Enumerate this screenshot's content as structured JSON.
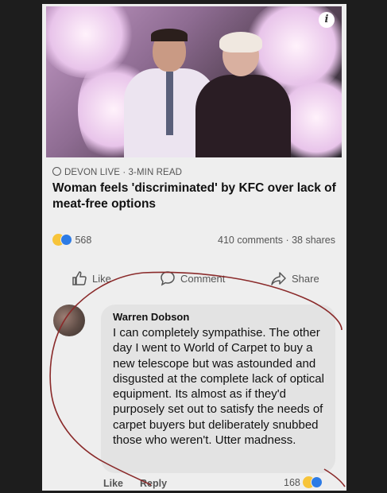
{
  "post": {
    "source_label": "DEVON LIVE · 3-MIN READ",
    "headline": "Woman feels 'discriminated' by KFC over lack of meat-free options",
    "reaction_count": "568",
    "stats": "410 comments · 38 shares",
    "info_icon": "i"
  },
  "actions": {
    "like": "Like",
    "comment": "Comment",
    "share": "Share"
  },
  "comment": {
    "author": "Warren Dobson",
    "text": "I can completely sympathise. The other day I went to World of Carpet to buy a new telescope but was astounded and disgusted at the complete lack of optical equipment. Its almost as if they'd purposely set out to satisfy the needs of carpet buyers but deliberately snubbed those who weren't. Utter madness.",
    "like_label": "Like",
    "reply_label": "Reply",
    "reaction_count": "168"
  },
  "colors": {
    "background": "#1d1d1d",
    "card": "#eeeeee",
    "bubble": "#e3e3e3",
    "like_blue": "#2d7be5",
    "haha_yellow": "#f7c43a",
    "pen_annotation": "#8a2a2a"
  }
}
